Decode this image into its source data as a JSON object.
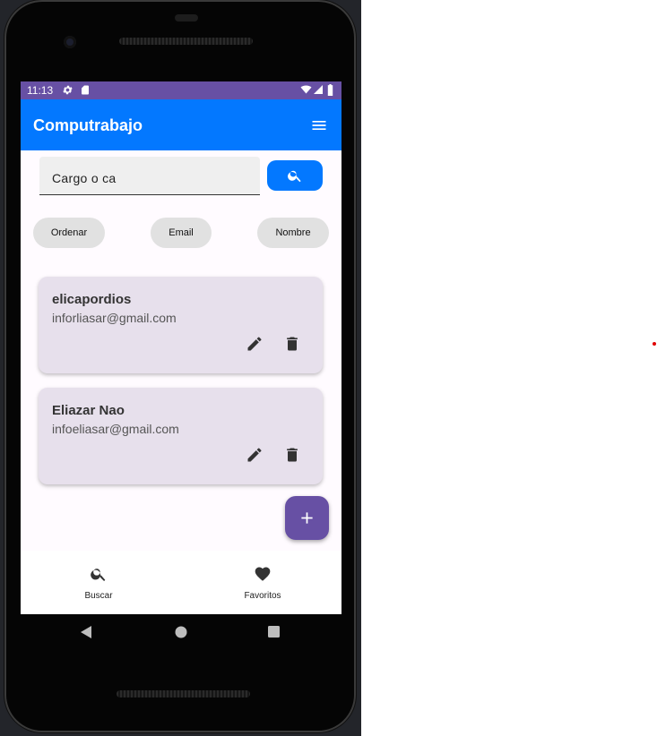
{
  "status_bar": {
    "time": "11:13"
  },
  "app_bar": {
    "title": "Computrabajo"
  },
  "search": {
    "value": "Cargo o ca"
  },
  "chips": {
    "sort_label": "Ordenar",
    "email_label": "Email",
    "name_label": "Nombre"
  },
  "contacts": [
    {
      "name": "elicapordios",
      "email": "inforliasar@gmail.com"
    },
    {
      "name": "Eliazar Nao",
      "email": "infoeliasar@gmail.com"
    }
  ],
  "bottom_nav": {
    "search_label": "Buscar",
    "favorites_label": "Favoritos"
  },
  "colors": {
    "app_bar": "#0378ff",
    "status_bar": "#6750a4",
    "fab": "#6750a4",
    "card": "#e7e0ec",
    "chip": "#e1e1e1"
  },
  "icons": {
    "status": [
      "gear-icon",
      "sd-card-icon",
      "wifi-icon",
      "signal-icon",
      "battery-icon"
    ],
    "app_bar": "menu-icon",
    "search_button": "search-icon",
    "card_actions": [
      "edit-icon",
      "delete-icon"
    ],
    "fab": "add-icon",
    "bottom_nav": [
      "search-icon",
      "heart-icon"
    ],
    "system_nav": [
      "back-icon",
      "home-icon",
      "recents-icon"
    ]
  }
}
